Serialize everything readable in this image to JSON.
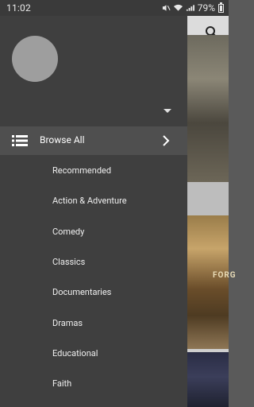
{
  "status_bar": {
    "time": "11:02",
    "battery": "79%"
  },
  "drawer": {
    "header": {
      "avatar": "account-avatar"
    },
    "browse_all": {
      "label": "Browse All"
    },
    "categories": [
      "Recommended",
      "Action & Adventure",
      "Comedy",
      "Classics",
      "Documentaries",
      "Dramas",
      "Educational",
      "Faith"
    ]
  },
  "background": {
    "poster_text": "FORG"
  },
  "colors": {
    "drawer_bg": "#3f3f3f",
    "selected_row_bg": "#4f4f4f",
    "status_bar_bg": "#3a3a3a"
  }
}
